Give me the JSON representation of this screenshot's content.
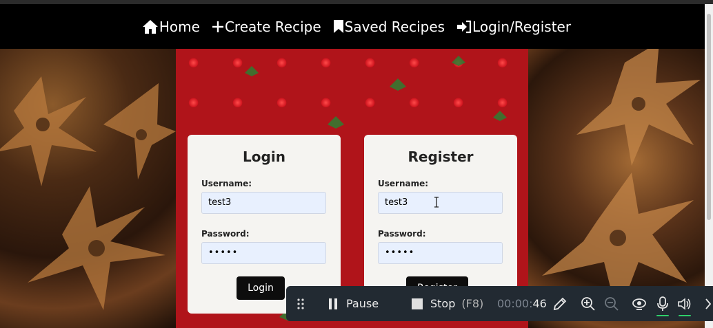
{
  "navbar": {
    "items": [
      {
        "label": "Home",
        "icon": "home-icon"
      },
      {
        "label": "Create Recipe",
        "icon": "plus-icon"
      },
      {
        "label": "Saved Recipes",
        "icon": "bookmark-icon"
      },
      {
        "label": "Login/Register",
        "icon": "login-icon"
      }
    ]
  },
  "login": {
    "title": "Login",
    "username_label": "Username:",
    "username_value": "test3",
    "password_label": "Password:",
    "password_value": "•••••",
    "button_label": "Login"
  },
  "register": {
    "title": "Register",
    "username_label": "Username:",
    "username_value": "test3",
    "password_label": "Password:",
    "password_value": "•••••",
    "button_label": "Register"
  },
  "recorder": {
    "pause_label": "Pause",
    "stop_label": "Stop",
    "stop_shortcut": "(F8)",
    "timer_dim": "00:00:",
    "timer_bright": "46"
  },
  "colors": {
    "navbar_bg": "#000000",
    "panel_bg": "#f5f4f1",
    "input_bg": "#e8f0fe",
    "button_bg": "#0d0d0d",
    "recorder_bg": "#222a32",
    "recorder_accent": "#2fd06a"
  }
}
